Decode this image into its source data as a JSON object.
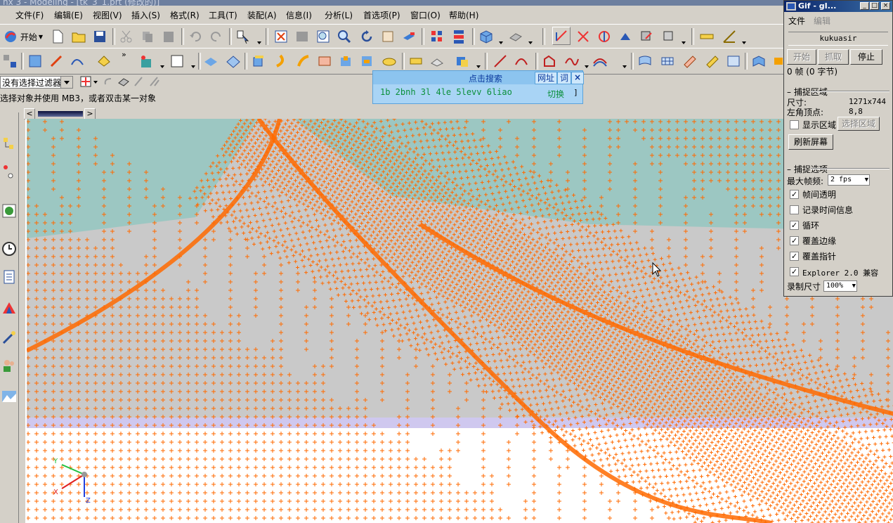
{
  "title_fragment": "nx 3 - Modeling - [tk_3_1.prt (修改的)]",
  "menu": [
    {
      "label": "文件(F)"
    },
    {
      "label": "编辑(E)"
    },
    {
      "label": "视图(V)"
    },
    {
      "label": "插入(S)"
    },
    {
      "label": "格式(R)"
    },
    {
      "label": "工具(T)"
    },
    {
      "label": "装配(A)"
    },
    {
      "label": "信息(I)"
    },
    {
      "label": "分析(L)"
    },
    {
      "label": "首选项(P)"
    },
    {
      "label": "窗口(O)"
    },
    {
      "label": "帮助(H)"
    }
  ],
  "toolbar": {
    "start_label": "开始",
    "filter_value": "没有选择过滤器"
  },
  "status": {
    "prompt": "选择对象并使用 MB3，或者双击某一对象"
  },
  "search_popup": {
    "title": "点击搜索",
    "url_btn": "网址",
    "word_btn": "词",
    "close": "×",
    "keys": "1b 2bnh 3l 4le 5levv 6liao",
    "switch": "切换",
    "bracket": "]"
  },
  "viewport": {
    "axes": {
      "x": "X",
      "y": "Y",
      "z": "Z"
    },
    "mesh_color": "#ff6a00",
    "background": "#c9c9c9"
  },
  "gif_window": {
    "title": "Gif - gI...",
    "menu_file": "文件",
    "menu_edit": "编辑",
    "username": "kukuasir",
    "btn_start": "开始",
    "btn_grab": "抓取",
    "btn_stop": "停止",
    "frames": "0 帧 (0 字节)",
    "capture_area_section": "捕捉区域",
    "size_label": "尺寸:",
    "size_value": "1271x744",
    "corner_label": "左角顶点:",
    "corner_value": "8,8",
    "show_area": "显示区域",
    "select_area": "选择区域",
    "refresh": "刷新屏幕",
    "capture_options_section": "捕捉选项",
    "max_fps_label": "最大帧频:",
    "max_fps_value": "2 fps",
    "options": [
      {
        "label": "帧间透明",
        "checked": true
      },
      {
        "label": "记录时间信息",
        "checked": false
      },
      {
        "label": "循环",
        "checked": true
      },
      {
        "label": "覆盖边缘",
        "checked": true
      },
      {
        "label": "覆盖指针",
        "checked": true
      },
      {
        "label": "Explorer 2.0 兼容",
        "checked": true
      }
    ],
    "record_size_label": "录制尺寸",
    "record_size_value": "100%"
  }
}
